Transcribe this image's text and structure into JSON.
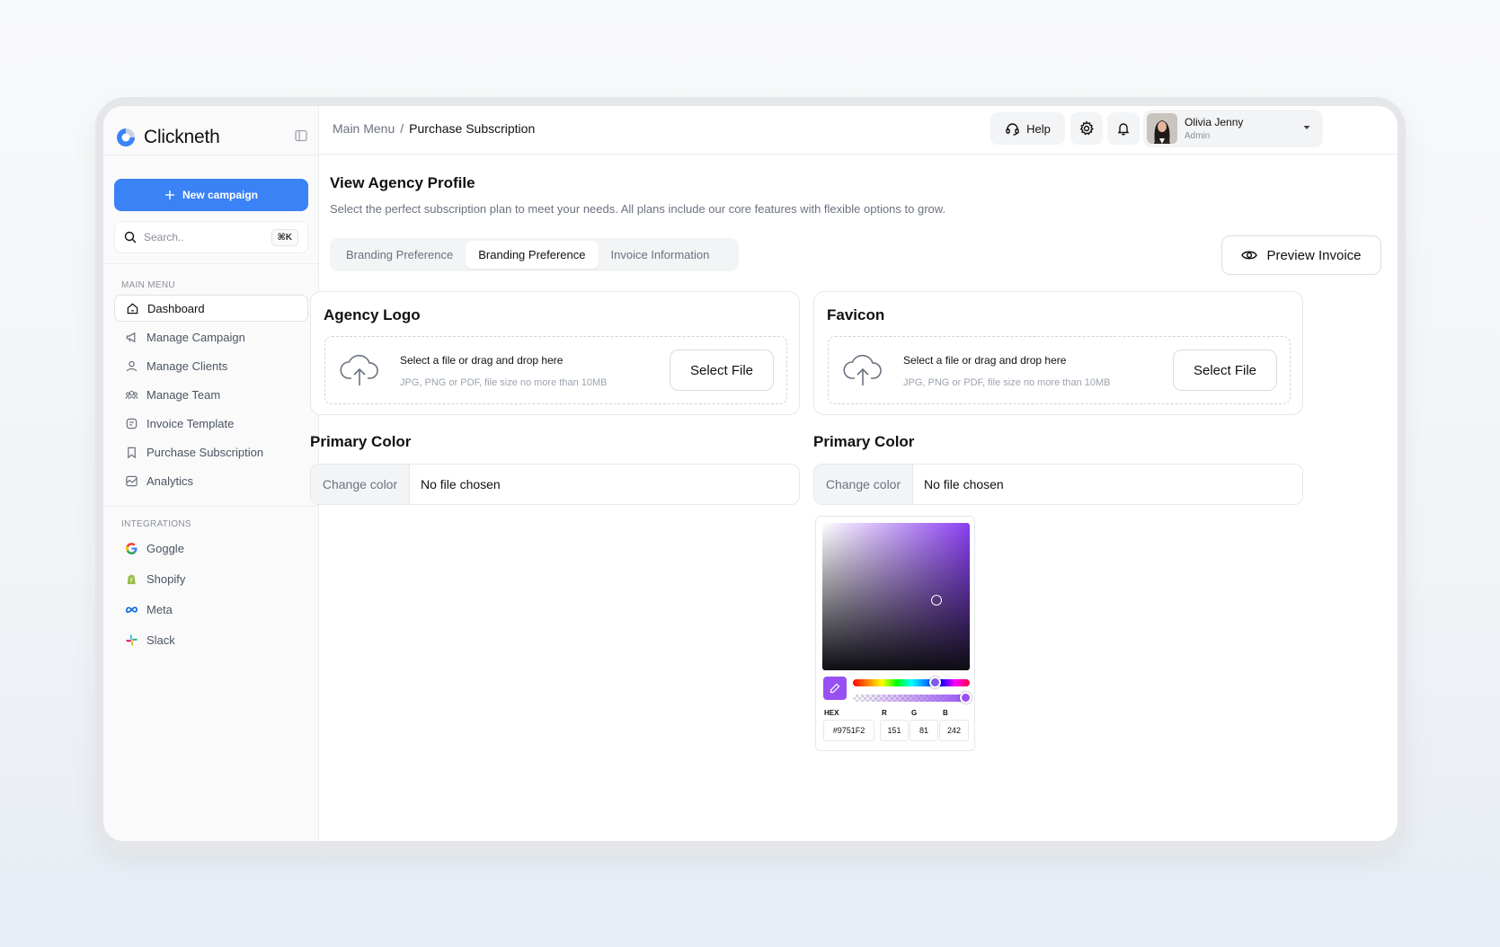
{
  "app": {
    "name": "Clickneth"
  },
  "sidebar": {
    "new_campaign_label": "New campaign",
    "search": {
      "placeholder": "Search..",
      "shortcut": "⌘K"
    },
    "main_menu_label": "MAIN MENU",
    "main_menu": [
      {
        "label": "Dashboard",
        "icon": "home-icon",
        "active": true
      },
      {
        "label": "Manage Campaign",
        "icon": "megaphone-icon"
      },
      {
        "label": "Manage Clients",
        "icon": "user-icon"
      },
      {
        "label": "Manage Team",
        "icon": "users-icon"
      },
      {
        "label": "Invoice Template",
        "icon": "invoice-icon"
      },
      {
        "label": "Purchase Subscription",
        "icon": "bookmark-icon"
      },
      {
        "label": "Analytics",
        "icon": "chart-icon"
      }
    ],
    "integrations_label": "INTEGRATIONS",
    "integrations": [
      {
        "label": "Goggle",
        "icon": "google-icon"
      },
      {
        "label": "Shopify",
        "icon": "shopify-icon"
      },
      {
        "label": "Meta",
        "icon": "meta-icon"
      },
      {
        "label": "Slack",
        "icon": "slack-icon"
      }
    ]
  },
  "header": {
    "breadcrumb": {
      "parent": "Main Menu",
      "separator": "/",
      "current": "Purchase Subscription"
    },
    "help_label": "Help",
    "user": {
      "name": "Olivia Jenny",
      "role": "Admin"
    }
  },
  "main": {
    "title": "View Agency Profile",
    "description": "Select the perfect subscription plan to meet your needs. All plans include our core features with flexible options to grow.",
    "tabs": [
      {
        "label": "Branding Preference",
        "active": false
      },
      {
        "label": "Branding Preference",
        "active": true
      },
      {
        "label": "Invoice Information",
        "active": false
      }
    ],
    "preview_invoice_label": "Preview Invoice",
    "upload_cards": [
      {
        "title": "Agency Logo",
        "drop_text": "Select a file or drag and drop here",
        "hint": "JPG, PNG or PDF, file size no more than 10MB",
        "button": "Select File"
      },
      {
        "title": "Favicon",
        "drop_text": "Select a file or drag and drop here",
        "hint": "JPG, PNG or PDF, file size no more than 10MB",
        "button": "Select File"
      }
    ],
    "color_fields": [
      {
        "title": "Primary Color",
        "button": "Change color",
        "value": "No file chosen"
      },
      {
        "title": "Primary Color",
        "button": "Change color",
        "value": "No file chosen"
      }
    ],
    "color_picker": {
      "hex_label": "HEX",
      "r_label": "R",
      "g_label": "G",
      "b_label": "B",
      "hex": "#9751F2",
      "r": "151",
      "g": "81",
      "b": "242",
      "alpha": 1.0
    }
  },
  "colors": {
    "accent": "#3b82f6",
    "picked": "#9751F2",
    "text": "#111827",
    "muted": "#6b7280"
  }
}
